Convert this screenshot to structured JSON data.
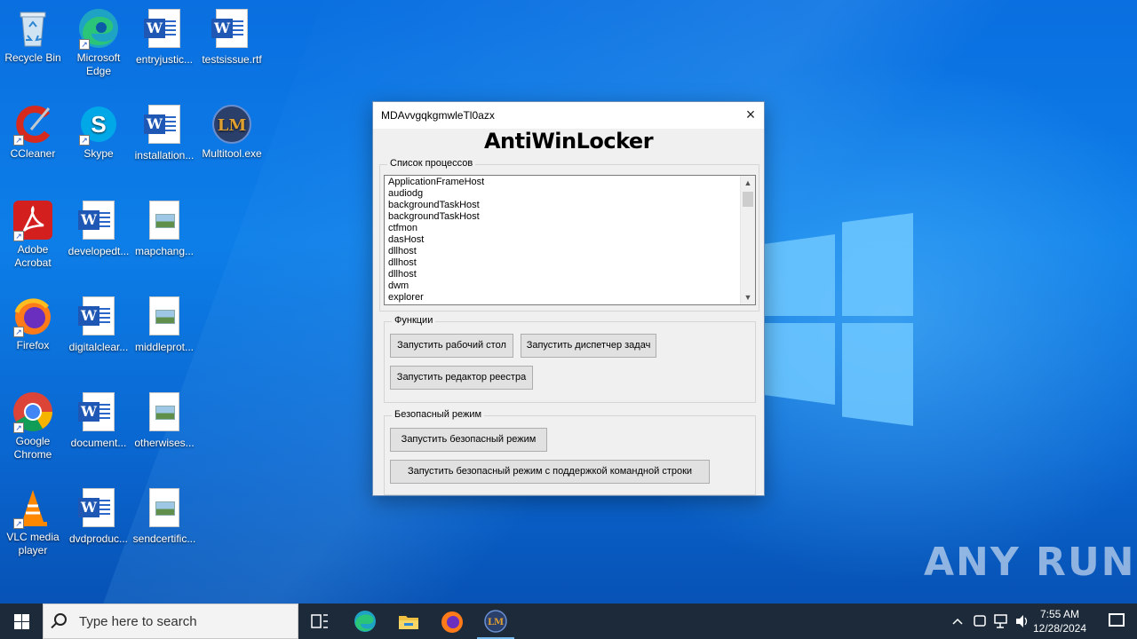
{
  "desktop": {
    "icons": [
      {
        "label": "Recycle Bin",
        "icon": "recycle-bin-icon"
      },
      {
        "label": "Microsoft Edge",
        "icon": "edge-icon"
      },
      {
        "label": "entryjustic...",
        "icon": "word-document-icon"
      },
      {
        "label": "testsissue.rtf",
        "icon": "word-document-icon"
      },
      {
        "label": "CCleaner",
        "icon": "ccleaner-icon"
      },
      {
        "label": "Skype",
        "icon": "skype-icon"
      },
      {
        "label": "installation...",
        "icon": "word-document-icon"
      },
      {
        "label": "Multitool.exe",
        "icon": "multitool-icon"
      },
      {
        "label": "Adobe Acrobat",
        "icon": "acrobat-icon"
      },
      {
        "label": "developedt...",
        "icon": "word-document-icon"
      },
      {
        "label": "mapchang...",
        "icon": "image-file-icon"
      },
      {
        "label": "Firefox",
        "icon": "firefox-icon"
      },
      {
        "label": "digitalclear...",
        "icon": "word-document-icon"
      },
      {
        "label": "middleprot...",
        "icon": "image-file-icon"
      },
      {
        "label": "Google Chrome",
        "icon": "chrome-icon"
      },
      {
        "label": "document...",
        "icon": "word-document-icon"
      },
      {
        "label": "otherwises...",
        "icon": "image-file-icon"
      },
      {
        "label": "VLC media player",
        "icon": "vlc-icon"
      },
      {
        "label": "dvdproduc...",
        "icon": "word-document-icon"
      },
      {
        "label": "sendcertific...",
        "icon": "image-file-icon"
      }
    ]
  },
  "window": {
    "title": "MDAvvgqkgmwleTl0azx",
    "close_icon": "×",
    "heading": "AntiWinLocker",
    "process_group": {
      "label": "Список процессов",
      "processes": [
        "ApplicationFrameHost",
        "audiodg",
        "backgroundTaskHost",
        "backgroundTaskHost",
        "ctfmon",
        "dasHost",
        "dllhost",
        "dllhost",
        "dllhost",
        "dwm",
        "explorer"
      ]
    },
    "functions_group": {
      "label": "Функции",
      "run_desktop": "Запустить рабочий стол",
      "run_taskmgr": "Запустить диспетчер задач",
      "run_regedit": "Запустить редактор реестра"
    },
    "safemode_group": {
      "label": "Безопасный режим",
      "run_safemode": "Запустить безопасный режим",
      "run_safemode_cmd": "Запустить безопасный режим с поддержкой командной строки"
    }
  },
  "taskbar": {
    "search_placeholder": "Type here to search",
    "time": "7:55 AM",
    "date": "12/28/2024"
  },
  "watermark": "ANY RUN",
  "colors": {
    "taskbar": "#1c2a3a",
    "window_bg": "#f0f0f0",
    "button_bg": "#e1e1e1"
  }
}
